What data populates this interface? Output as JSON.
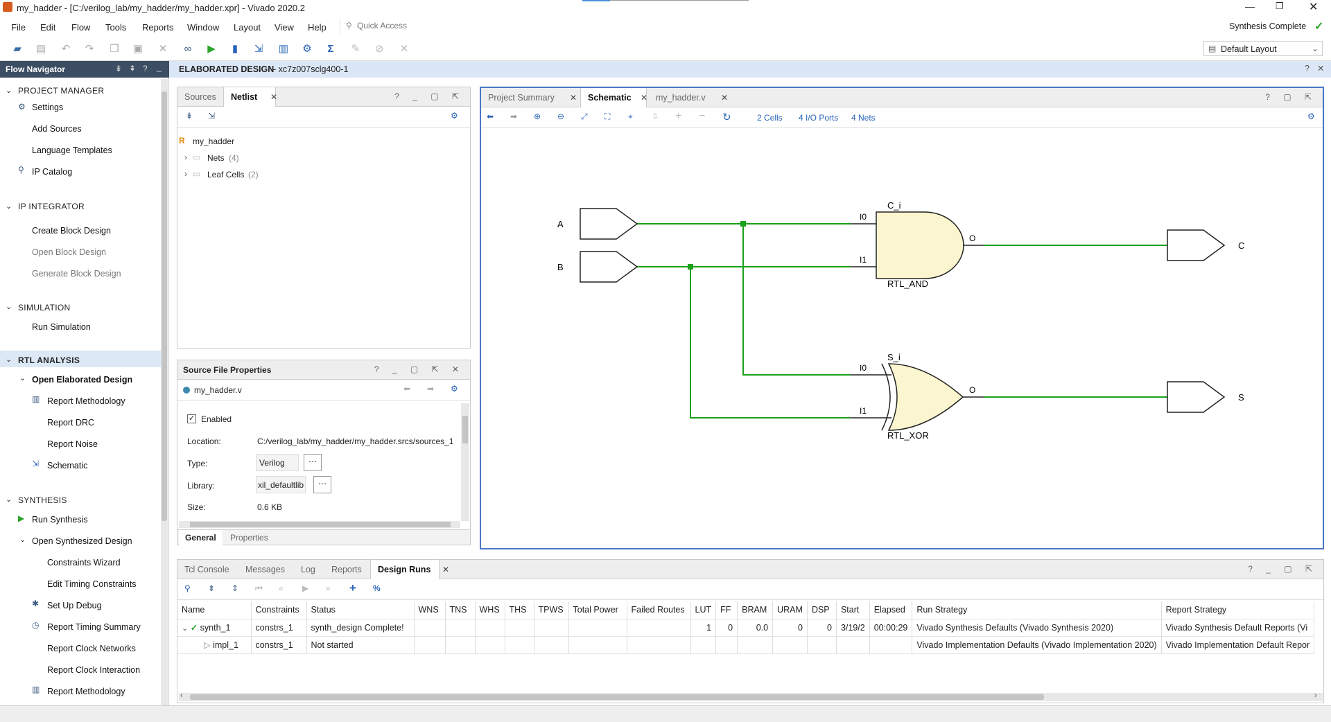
{
  "window": {
    "title": "my_hadder - [C:/verilog_lab/my_hadder/my_hadder.xpr] - Vivado 2020.2",
    "status": "Synthesis Complete",
    "layout": "Default Layout"
  },
  "menu": [
    "File",
    "Edit",
    "Flow",
    "Tools",
    "Reports",
    "Window",
    "Layout",
    "View",
    "Help"
  ],
  "quick_access": {
    "placeholder": "Quick Access"
  },
  "flow_nav": {
    "title": "Flow Navigator",
    "project_manager": {
      "label": "PROJECT MANAGER",
      "items": [
        "Settings",
        "Add Sources",
        "Language Templates",
        "IP Catalog"
      ]
    },
    "ip_integrator": {
      "label": "IP INTEGRATOR",
      "items": [
        "Create Block Design",
        "Open Block Design",
        "Generate Block Design"
      ]
    },
    "simulation": {
      "label": "SIMULATION",
      "items": [
        "Run Simulation"
      ]
    },
    "rtl_analysis": {
      "label": "RTL ANALYSIS",
      "open": "Open Elaborated Design",
      "items": [
        "Report Methodology",
        "Report DRC",
        "Report Noise",
        "Schematic"
      ]
    },
    "synthesis": {
      "label": "SYNTHESIS",
      "run": "Run Synthesis",
      "open": "Open Synthesized Design",
      "items": [
        "Constraints Wizard",
        "Edit Timing Constraints",
        "Set Up Debug",
        "Report Timing Summary",
        "Report Clock Networks",
        "Report Clock Interaction",
        "Report Methodology"
      ]
    }
  },
  "elab": {
    "title": "ELABORATED DESIGN",
    "part": " - xc7z007sclg400-1"
  },
  "sources_panel": {
    "tabs": [
      "Sources",
      "Netlist"
    ],
    "root": "my_hadder",
    "nets": "Nets",
    "nets_count": "(4)",
    "leaf": "Leaf Cells",
    "leaf_count": "(2)"
  },
  "props_panel": {
    "title": "Source File Properties",
    "file": "my_hadder.v",
    "enabled": "Enabled",
    "location_label": "Location:",
    "location": "C:/verilog_lab/my_hadder/my_hadder.srcs/sources_1",
    "type_label": "Type:",
    "type": "Verilog",
    "library_label": "Library:",
    "library": "xil_defaultlib",
    "size_label": "Size:",
    "size": "0.6 KB",
    "tabs": [
      "General",
      "Properties"
    ]
  },
  "schematic": {
    "tabs": [
      "Project Summary",
      "Schematic",
      "my_hadder.v"
    ],
    "cells": "2 Cells",
    "ports": "4 I/O Ports",
    "nets": "4 Nets",
    "inputs": [
      "A",
      "B"
    ],
    "outputs": [
      "C",
      "S"
    ],
    "and_gate": {
      "inst": "C_i",
      "type": "RTL_AND",
      "pins": [
        "I0",
        "I1",
        "O"
      ]
    },
    "xor_gate": {
      "inst": "S_i",
      "type": "RTL_XOR",
      "pins": [
        "I0",
        "I1",
        "O"
      ]
    }
  },
  "runs_panel": {
    "tabs": [
      "Tcl Console",
      "Messages",
      "Log",
      "Reports",
      "Design Runs"
    ],
    "columns": [
      "Name",
      "Constraints",
      "Status",
      "WNS",
      "TNS",
      "WHS",
      "THS",
      "TPWS",
      "Total Power",
      "Failed Routes",
      "LUT",
      "FF",
      "BRAM",
      "URAM",
      "DSP",
      "Start",
      "Elapsed",
      "Run Strategy",
      "Report Strategy"
    ],
    "rows": [
      {
        "name": "synth_1",
        "constraints": "constrs_1",
        "status": "synth_design Complete!",
        "lut": "1",
        "ff": "0",
        "bram": "0.0",
        "uram": "0",
        "dsp": "0",
        "start": "3/19/2",
        "elapsed": "00:00:29",
        "run_strategy": "Vivado Synthesis Defaults (Vivado Synthesis 2020)",
        "report_strategy": "Vivado Synthesis Default Reports (Vi"
      },
      {
        "name": "impl_1",
        "constraints": "constrs_1",
        "status": "Not started",
        "lut": "",
        "ff": "",
        "bram": "",
        "uram": "",
        "dsp": "",
        "start": "",
        "elapsed": "",
        "run_strategy": "Vivado Implementation Defaults (Vivado Implementation 2020)",
        "report_strategy": "Vivado Implementation Default Repor"
      }
    ]
  }
}
